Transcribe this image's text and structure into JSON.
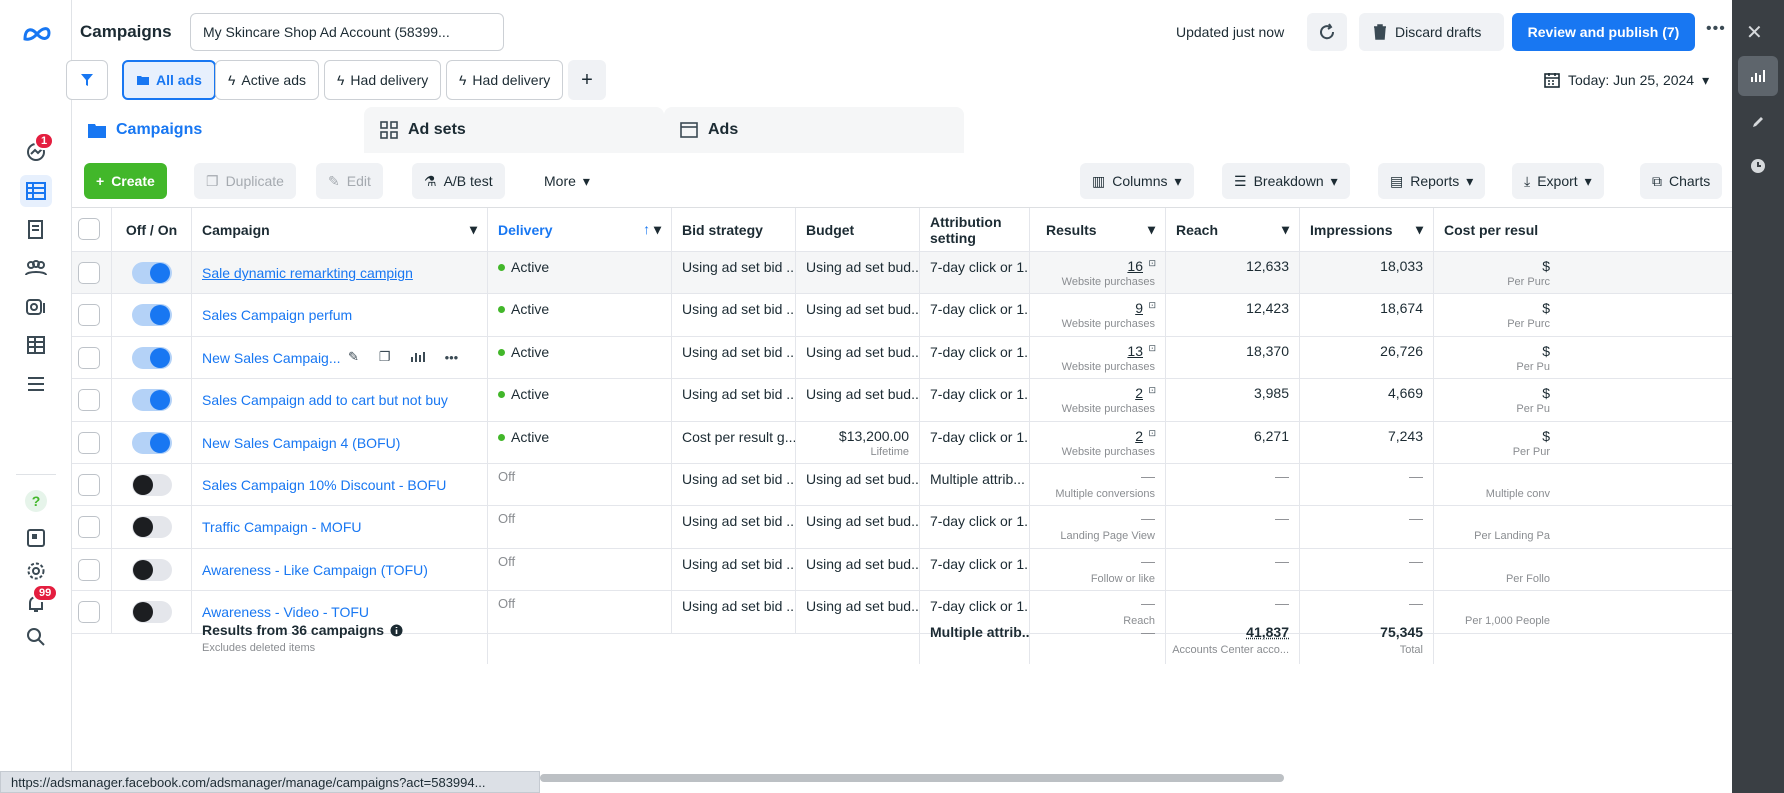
{
  "header": {
    "title": "Campaigns",
    "account": "My Skincare Shop Ad Account (58399...",
    "updated": "Updated just now",
    "discard": "Discard drafts",
    "publish": "Review and publish (7)"
  },
  "rail": {
    "notif_badge": "1",
    "alerts_badge": "99"
  },
  "chips": {
    "all_ads": "All ads",
    "active_ads": "Active ads",
    "had_delivery_1": "Had delivery",
    "had_delivery_2": "Had delivery",
    "date": "Today: Jun 25, 2024"
  },
  "tabs": {
    "campaigns": "Campaigns",
    "adsets": "Ad sets",
    "ads": "Ads"
  },
  "toolbar": {
    "create": "Create",
    "duplicate": "Duplicate",
    "edit": "Edit",
    "abtest": "A/B test",
    "more": "More",
    "columns": "Columns",
    "breakdown": "Breakdown",
    "reports": "Reports",
    "export": "Export",
    "charts": "Charts"
  },
  "columns": {
    "offon": "Off / On",
    "campaign": "Campaign",
    "delivery": "Delivery",
    "bid": "Bid strategy",
    "budget": "Budget",
    "attr1": "Attribution",
    "attr2": "setting",
    "results": "Results",
    "reach": "Reach",
    "impressions": "Impressions",
    "cpr": "Cost per resul"
  },
  "rows": [
    {
      "on": true,
      "name": "Sale dynamic remarkting campign",
      "delivery": "Active",
      "bid": "Using ad set bid ...",
      "budget": "Using ad set bud...",
      "budget_sub": "",
      "attr": "7-day click or 1...",
      "results": "16",
      "results_sub": "Website purchases",
      "reach": "12,633",
      "impressions": "18,033",
      "cpr": "$",
      "cpr_sub": "Per Purc"
    },
    {
      "on": true,
      "name": "Sales Campaign perfum",
      "delivery": "Active",
      "bid": "Using ad set bid ...",
      "budget": "Using ad set bud...",
      "budget_sub": "",
      "attr": "7-day click or 1...",
      "results": "9",
      "results_sub": "Website purchases",
      "reach": "12,423",
      "impressions": "18,674",
      "cpr": "$",
      "cpr_sub": "Per Purc"
    },
    {
      "on": true,
      "name": "New Sales Campaig...",
      "delivery": "Active",
      "bid": "Using ad set bid ...",
      "budget": "Using ad set bud...",
      "budget_sub": "",
      "attr": "7-day click or 1...",
      "results": "13",
      "results_sub": "Website purchases",
      "reach": "18,370",
      "impressions": "26,726",
      "cpr": "$",
      "cpr_sub": "Per Pu"
    },
    {
      "on": true,
      "name": "Sales Campaign add to cart but not buy",
      "delivery": "Active",
      "bid": "Using ad set bid ...",
      "budget": "Using ad set bud...",
      "budget_sub": "",
      "attr": "7-day click or 1...",
      "results": "2",
      "results_sub": "Website purchases",
      "reach": "3,985",
      "impressions": "4,669",
      "cpr": "$",
      "cpr_sub": "Per Pu"
    },
    {
      "on": true,
      "name": "New Sales Campaign 4 (BOFU)",
      "delivery": "Active",
      "bid": "Cost per result g...",
      "budget": "$13,200.00",
      "budget_sub": "Lifetime",
      "attr": "7-day click or 1...",
      "results": "2",
      "results_sub": "Website purchases",
      "reach": "6,271",
      "impressions": "7,243",
      "cpr": "$",
      "cpr_sub": "Per Pur"
    },
    {
      "on": false,
      "name": "Sales Campaign 10% Discount - BOFU",
      "delivery": "Off",
      "bid": "Using ad set bid ...",
      "budget": "Using ad set bud...",
      "budget_sub": "",
      "attr": "Multiple attrib...",
      "results": "—",
      "results_sub": "Multiple conversions",
      "reach": "—",
      "impressions": "—",
      "cpr": "",
      "cpr_sub": "Multiple conv"
    },
    {
      "on": false,
      "name": "Traffic Campaign - MOFU",
      "delivery": "Off",
      "bid": "Using ad set bid ...",
      "budget": "Using ad set bud...",
      "budget_sub": "",
      "attr": "7-day click or 1...",
      "results": "—",
      "results_sub": "Landing Page View",
      "reach": "—",
      "impressions": "—",
      "cpr": "",
      "cpr_sub": "Per Landing Pa"
    },
    {
      "on": false,
      "name": "Awareness - Like Campaign (TOFU)",
      "delivery": "Off",
      "bid": "Using ad set bid ...",
      "budget": "Using ad set bud...",
      "budget_sub": "",
      "attr": "7-day click or 1...",
      "results": "—",
      "results_sub": "Follow or like",
      "reach": "—",
      "impressions": "—",
      "cpr": "",
      "cpr_sub": "Per Follo"
    },
    {
      "on": false,
      "name": "Awareness - Video - TOFU",
      "delivery": "Off",
      "bid": "Using ad set bid ...",
      "budget": "Using ad set bud...",
      "budget_sub": "",
      "attr": "7-day click or 1...",
      "results": "—",
      "results_sub": "Reach",
      "reach": "—",
      "impressions": "—",
      "cpr": "",
      "cpr_sub": "Per 1,000 People"
    }
  ],
  "totals": {
    "label": "Results from 36 campaigns",
    "sub": "Excludes deleted items",
    "attr": "Multiple attrib...",
    "results": "—",
    "reach": "41,837",
    "reach_sub": "Accounts Center acco...",
    "impressions": "75,345",
    "impressions_sub": "Total"
  },
  "status_url": "https://adsmanager.facebook.com/adsmanager/manage/campaigns?act=583994..."
}
